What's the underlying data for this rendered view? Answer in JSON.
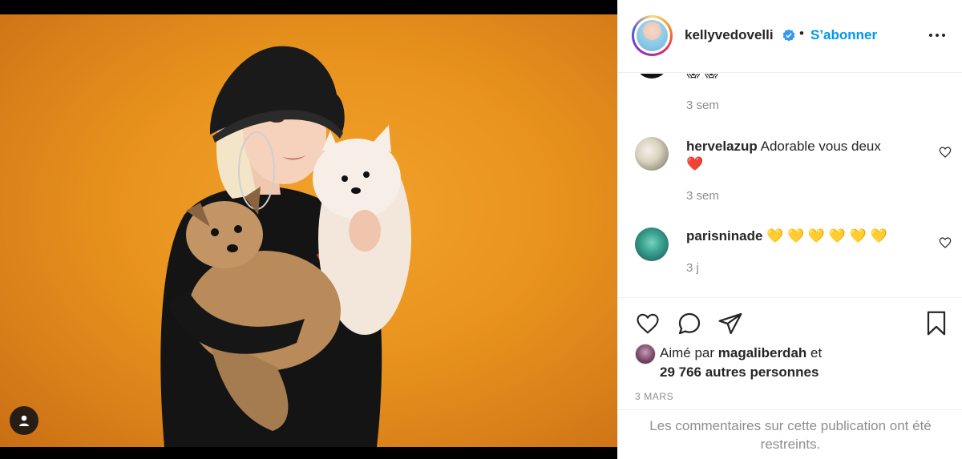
{
  "header": {
    "username": "kellyvedovelli",
    "separator": "•",
    "follow_label": "S’abonner",
    "more_icon": "more-horizontal-icon",
    "verified_icon": "verified-badge-icon"
  },
  "comments": [
    {
      "user": "",
      "text": "😱 😱",
      "time": "3 sem"
    },
    {
      "user": "hervelazup",
      "text": "Adorable vous deux",
      "emoji": "❤️",
      "time": "3 sem"
    },
    {
      "user": "parisninade",
      "text": "💛 💛 💛 💛 💛 💛",
      "time": "3 j"
    }
  ],
  "actions": {
    "like_icon": "heart-icon",
    "comment_icon": "comment-icon",
    "share_icon": "paper-plane-icon",
    "save_icon": "bookmark-icon"
  },
  "likes": {
    "prefix": "Aimé par ",
    "liked_by": "magaliberdah",
    "suffix": " et",
    "others": "29 766 autres personnes"
  },
  "post_date": "3 MARS",
  "restricted_notice": "Les commentaires sur cette publication ont été restreints.",
  "colors": {
    "link_blue": "#0095f6",
    "photo_background": "#e8931d",
    "muted_gray": "#8e8e8e"
  }
}
